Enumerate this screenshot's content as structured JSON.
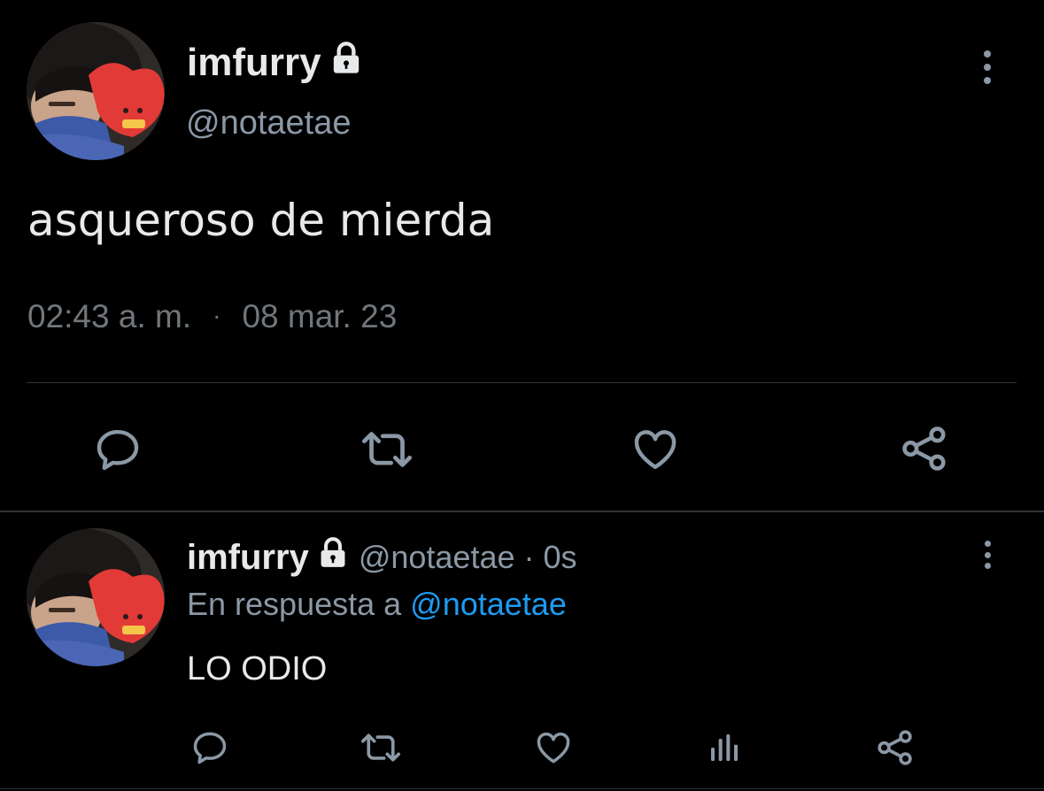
{
  "main_tweet": {
    "display_name": "imfurry",
    "handle": "@notaetae",
    "text": "asqueroso de mierda",
    "time": "02:43 a. m.",
    "separator": "·",
    "date": "08 mar. 23",
    "avatar_icon": "profile-photo-avatar",
    "lock_icon": "lock-icon",
    "more_icon": "more-vertical-icon",
    "actions": [
      "reply-icon",
      "retweet-icon",
      "like-icon",
      "share-icon"
    ]
  },
  "reply_tweet": {
    "display_name": "imfurry",
    "handle_time": "@notaetae · 0s",
    "reply_prefix": "En respuesta a",
    "reply_to": "@notaetae",
    "text": "LO ODIO",
    "avatar_icon": "profile-photo-avatar",
    "lock_icon": "lock-icon",
    "more_icon": "more-vertical-icon",
    "actions": [
      "reply-icon",
      "retweet-icon",
      "like-icon",
      "analytics-icon",
      "share-icon"
    ]
  },
  "colors": {
    "background": "#000000",
    "text_primary": "#e7e9ea",
    "text_secondary": "#8b98a5",
    "link": "#1d9bf0",
    "divider": "#2f3336"
  }
}
